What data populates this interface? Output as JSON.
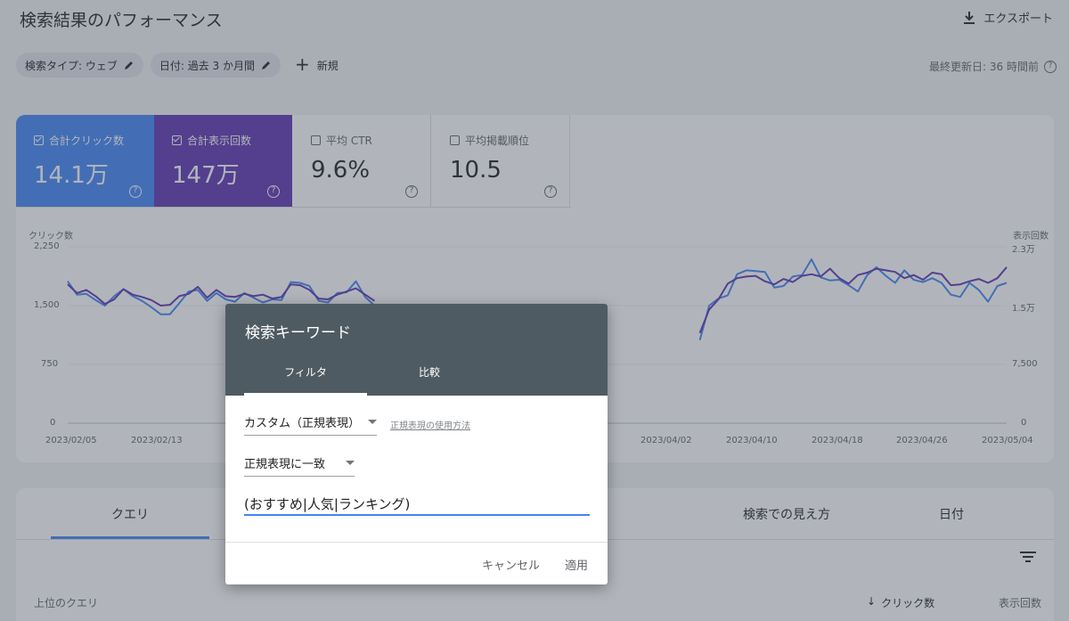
{
  "header": {
    "title": "検索結果のパフォーマンス",
    "export_label": "エクスポート"
  },
  "filters": {
    "search_type": "検索タイプ: ウェブ",
    "date": "日付: 過去 3 か月間",
    "new_label": "新規",
    "last_updated": "最終更新日: 36 時間前"
  },
  "metrics": [
    {
      "label": "合計クリック数",
      "value": "14.1万",
      "checked": true
    },
    {
      "label": "合計表示回数",
      "value": "147万",
      "checked": true
    },
    {
      "label": "平均 CTR",
      "value": "9.6%",
      "checked": false
    },
    {
      "label": "平均掲載順位",
      "value": "10.5",
      "checked": false
    }
  ],
  "chart": {
    "left_axis_title": "クリック数",
    "right_axis_title": "表示回数",
    "left_ticks": [
      "2,250",
      "1,500",
      "750",
      "0"
    ],
    "right_ticks": [
      "2.3万",
      "1.5万",
      "7,500",
      "0"
    ],
    "x_ticks": [
      "2023/02/05",
      "2023/02/13",
      "2023/04/02",
      "2023/04/10",
      "2023/04/18",
      "2023/04/26",
      "2023/05/04"
    ],
    "colors": {
      "clicks": "#4285f4",
      "impressions": "#5e35b1"
    }
  },
  "chart_data": {
    "type": "line",
    "xlim": [
      "2023/02/04",
      "2023/05/05"
    ],
    "ylim_left": [
      0,
      2250
    ],
    "ylim_right": [
      0,
      23000
    ],
    "series": [
      {
        "name": "クリック数",
        "axis": "left",
        "values": [
          1810,
          1640,
          1650,
          1570,
          1500,
          1620,
          1710,
          1620,
          1560,
          1480,
          1390,
          1390,
          1530,
          1680,
          1700,
          1560,
          1660,
          1580,
          1550,
          1660,
          1600,
          1540,
          1580,
          1570,
          1800,
          1790,
          1750,
          1560,
          1540,
          1660,
          1670,
          1810,
          1610,
          1500,
          null,
          null,
          null,
          null,
          null,
          null,
          null,
          null,
          null,
          null,
          null,
          null,
          null,
          null,
          null,
          null,
          null,
          null,
          null,
          null,
          null,
          null,
          null,
          null,
          null,
          null,
          null,
          null,
          null,
          null,
          null,
          null,
          null,
          null,
          1060,
          1500,
          1590,
          1630,
          1900,
          1950,
          1940,
          1930,
          1730,
          1750,
          1870,
          1890,
          2090,
          1860,
          1820,
          1830,
          1760,
          1680,
          1890,
          1990,
          1880,
          1790,
          1950,
          1830,
          1800,
          1850,
          1790,
          1640,
          1610,
          1790,
          1700,
          1550,
          1750,
          1790
        ]
      },
      {
        "name": "表示回数",
        "axis": "right",
        "values": [
          1770,
          1660,
          1700,
          1620,
          1520,
          1580,
          1710,
          1640,
          1610,
          1570,
          1500,
          1510,
          1620,
          1650,
          1740,
          1600,
          1700,
          1620,
          1610,
          1650,
          1620,
          1640,
          1590,
          1610,
          1770,
          1760,
          1700,
          1590,
          1580,
          1640,
          1680,
          1720,
          1640,
          1560,
          null,
          null,
          null,
          null,
          null,
          null,
          null,
          null,
          null,
          null,
          null,
          null,
          null,
          null,
          null,
          null,
          null,
          null,
          null,
          null,
          null,
          null,
          null,
          null,
          null,
          null,
          null,
          null,
          null,
          null,
          null,
          null,
          null,
          null,
          1150,
          1450,
          1580,
          1780,
          1850,
          1870,
          1880,
          1810,
          1770,
          1840,
          1800,
          1880,
          1900,
          1870,
          1970,
          1850,
          1780,
          1890,
          1920,
          1970,
          1950,
          1930,
          1850,
          1890,
          1830,
          1920,
          1900,
          1760,
          1770,
          1810,
          1840,
          1790,
          1850,
          1990
        ]
      }
    ]
  },
  "table": {
    "tabs": [
      "クエリ",
      "検索での見え方",
      "日付"
    ],
    "col_query": "上位のクエリ",
    "col_clicks": "クリック数",
    "col_impressions": "表示回数"
  },
  "dialog": {
    "title": "検索キーワード",
    "tabs": [
      "フィルタ",
      "比較"
    ],
    "type_select": "カスタム（正規表現）",
    "help_link": "正規表現の使用方法",
    "match_select": "正規表現に一致",
    "regex_value": "(おすすめ|人気|ランキング)",
    "cancel": "キャンセル",
    "apply": "適用"
  }
}
